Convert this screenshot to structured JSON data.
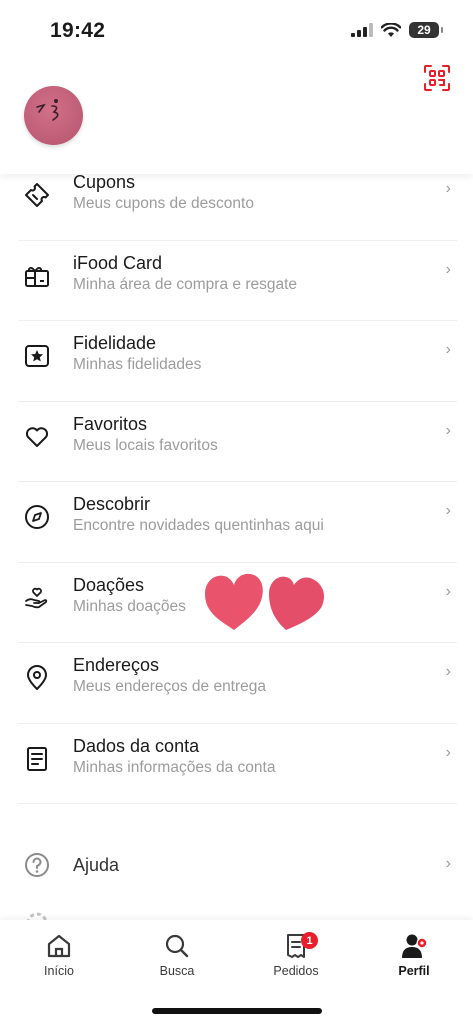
{
  "status_bar": {
    "time": "19:42",
    "battery": "29"
  },
  "profile": {
    "avatar_icon": "avatar-face"
  },
  "colors": {
    "accent": "#ea1d2c",
    "heart": "#e9536c"
  },
  "menu": [
    {
      "label": "Cupons",
      "subtitle": "Meus cupons de desconto",
      "icon": "ticket-icon"
    },
    {
      "label": "iFood Card",
      "subtitle": "Minha área de compra e resgate",
      "icon": "gift-card-icon"
    },
    {
      "label": "Fidelidade",
      "subtitle": "Minhas fidelidades",
      "icon": "star-badge-icon"
    },
    {
      "label": "Favoritos",
      "subtitle": "Meus locais favoritos",
      "icon": "heart-icon"
    },
    {
      "label": "Descobrir",
      "subtitle": "Encontre novidades quentinhas aqui",
      "icon": "compass-icon"
    },
    {
      "label": "Doações",
      "subtitle": "Minhas doações",
      "icon": "donation-hand-icon"
    },
    {
      "label": "Endereços",
      "subtitle": "Meus endereços de entrega",
      "icon": "location-pin-icon"
    },
    {
      "label": "Dados da conta",
      "subtitle": "Minhas informações da conta",
      "icon": "document-icon"
    }
  ],
  "help": {
    "label": "Ajuda"
  },
  "chevron": "›",
  "tabs": [
    {
      "label": "Início",
      "icon": "home-icon"
    },
    {
      "label": "Busca",
      "icon": "search-icon"
    },
    {
      "label": "Pedidos",
      "icon": "orders-icon",
      "badge": "1"
    },
    {
      "label": "Perfil",
      "icon": "profile-icon",
      "active": true
    }
  ]
}
